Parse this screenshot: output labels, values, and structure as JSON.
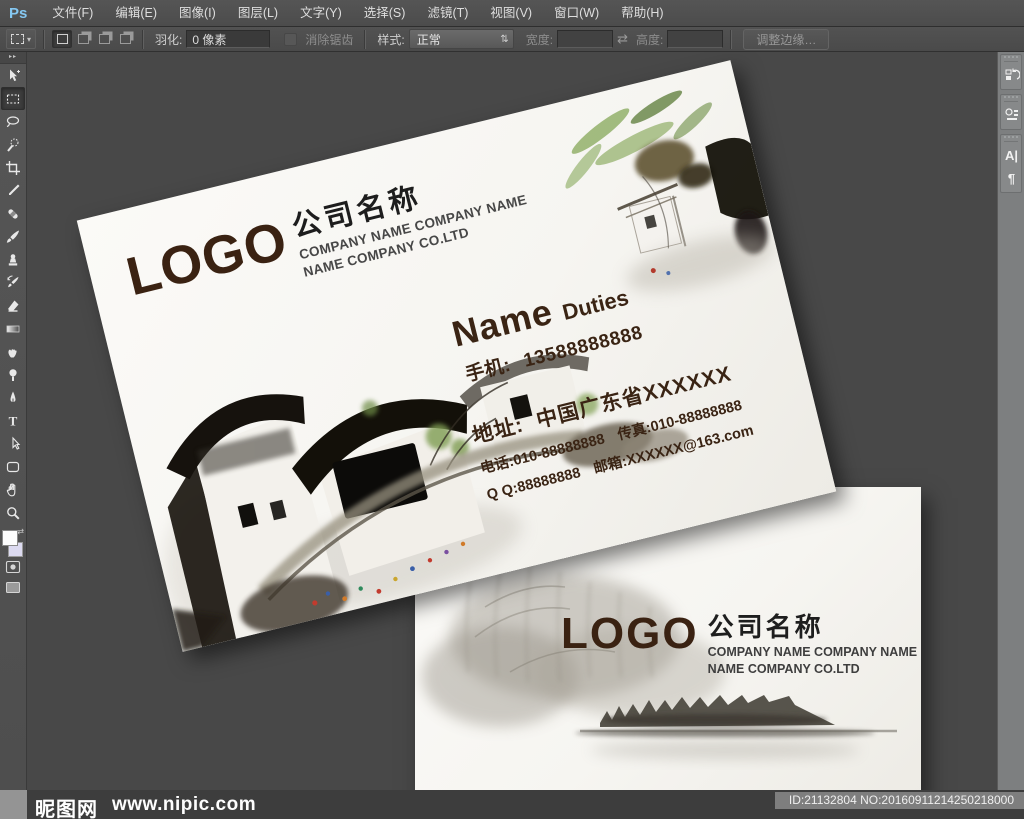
{
  "menu_bar": {
    "logo": "Ps",
    "items": [
      "文件(F)",
      "编辑(E)",
      "图像(I)",
      "图层(L)",
      "文字(Y)",
      "选择(S)",
      "滤镜(T)",
      "视图(V)",
      "窗口(W)",
      "帮助(H)"
    ]
  },
  "options_bar": {
    "feather_label": "羽化:",
    "feather_value": "0 像素",
    "antialias_label": "消除锯齿",
    "style_label": "样式:",
    "style_value": "正常",
    "width_label": "宽度:",
    "height_label": "高度:",
    "refine_edge_label": "调整边缘…"
  },
  "toolbar": {
    "selected_tool": "rectangular-marquee",
    "tools": [
      "move",
      "rectangular-marquee",
      "lasso",
      "quick-selection",
      "crop",
      "eyedropper",
      "spot-healing-brush",
      "brush",
      "clone-stamp",
      "history-brush",
      "eraser",
      "gradient",
      "smudge",
      "dodge",
      "pen",
      "type",
      "path-selection",
      "shape",
      "hand",
      "zoom"
    ]
  },
  "dock": {
    "panels": [
      "history",
      "adjustments",
      "character",
      "paragraph"
    ]
  },
  "icons": {
    "dropdown_arrow": "▾",
    "spinner": "⇅",
    "swap": "⇄",
    "toolbar_collapse": "▸▸",
    "type_t": "T",
    "character_panel": "A|",
    "paragraph_panel": "¶"
  },
  "canvas": {
    "card_front": {
      "logo": "LOGO",
      "company_cn": "公司名称",
      "company_en_1": "COMPANY NAME COMPANY NAME",
      "company_en_2": "NAME COMPANY CO.LTD",
      "person_name": "Name",
      "duties": "Duties",
      "mobile_label": "手机:",
      "mobile_number": "13588888888",
      "address_label": "地址:",
      "address_value": "中国广东省XXXXXX",
      "phone": "电话:010-88888888",
      "fax": "传真:010-88888888",
      "qq": "Q Q:88888888",
      "email": "邮箱:XXXXXX@163.com"
    },
    "card_back": {
      "logo": "LOGO",
      "company_cn": "公司名称",
      "company_en_1": "COMPANY NAME COMPANY NAME",
      "company_en_2": "NAME COMPANY CO.LTD"
    }
  },
  "watermark": {
    "site": "昵图网",
    "url": "www.nipic.com",
    "id_text": "ID:21132804 NO:20160911214250218000"
  },
  "colors": {
    "accent_brown": "#3a2212",
    "ui_chrome": "#4e4e4e",
    "canvas_bg": "#484848",
    "dock_bg": "#7d7f80",
    "card_bg": "#f7f6f2",
    "ps_blue": "#85c8f2"
  }
}
